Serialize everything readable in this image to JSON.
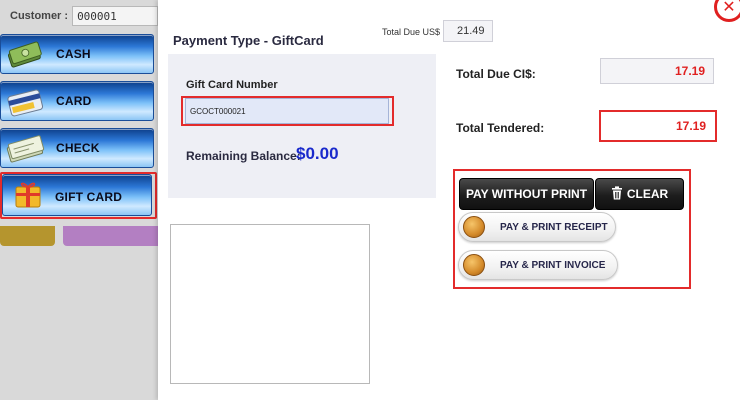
{
  "customer": {
    "label": "Customer :",
    "value": "000001"
  },
  "payment_methods": [
    {
      "label": "CASH",
      "icon": "cash-icon"
    },
    {
      "label": "CARD",
      "icon": "credit-card-icon"
    },
    {
      "label": "CHECK",
      "icon": "check-icon"
    },
    {
      "label": "GIFT CARD",
      "icon": "gift-card-icon",
      "selected": true
    }
  ],
  "modal": {
    "title": "Payment Type - GiftCard",
    "total_due_usd_label": "Total Due US$",
    "total_due_usd_value": "21.49",
    "gift_card_number_label": "Gift Card Number",
    "gift_card_number_value": "GCOCT000021",
    "remaining_balance_label": "Remaining Balance:",
    "remaining_balance_value": "$0.00",
    "total_due_ci_label": "Total Due CI$:",
    "total_due_ci_value": "17.19",
    "total_tendered_label": "Total Tendered:",
    "total_tendered_value": "17.19"
  },
  "actions": {
    "pay_without_print": "PAY WITHOUT PRINT",
    "clear": "CLEAR",
    "pay_print_receipt": "PAY & PRINT RECEIPT",
    "pay_print_invoice": "PAY & PRINT INVOICE"
  },
  "colors": {
    "highlight": "#e32b2b",
    "amount_red": "#e02020",
    "balance_blue": "#1a2acc",
    "button_blue": "#2c77d6"
  },
  "close_icon": "close-icon"
}
